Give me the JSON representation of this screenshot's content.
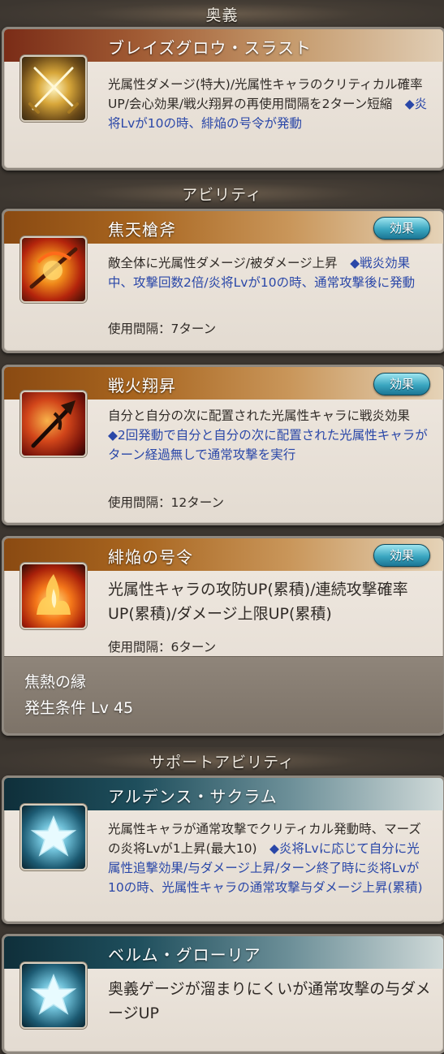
{
  "sections": {
    "ougi": "奥義",
    "abilities": "アビリティ",
    "support": "サポートアビリティ"
  },
  "ougi_card": {
    "name": "ブレイズグロウ・スラスト",
    "desc_plain": "光属性ダメージ(特大)/光属性キャラのクリティカル確率UP/会心効果/戦火翔昇の再使用間隔を2ターン短縮　",
    "desc_blue": "◆炎将Lvが10の時、緋焔の号令が発動",
    "icon": "crossed-swords-icon"
  },
  "abilities": [
    {
      "name": "焦天槍斧",
      "effect_label": "効果",
      "desc_plain": "敵全体に光属性ダメージ/被ダメージ上昇　",
      "desc_blue": "◆戦炎効果中、攻撃回数2倍/炎将Lvが10の時、通常攻撃後に発動",
      "interval": "使用間隔：7ターン",
      "icon": "fire-spear-icon"
    },
    {
      "name": "戦火翔昇",
      "effect_label": "効果",
      "desc_plain": "自分と自分の次に配置された光属性キャラに戦炎効果　",
      "desc_blue": "◆2回発動で自分と自分の次に配置された光属性キャラがターン経過無しで通常攻撃を実行",
      "interval": "使用間隔：12ターン",
      "icon": "halberd-icon"
    },
    {
      "name": "緋焔の号令",
      "effect_label": "効果",
      "desc_plain": "光属性キャラの攻防UP(累積)/連続攻撃確率UP(累積)/ダメージ上限UP(累積)",
      "interval": "使用間隔：6ターン",
      "condition_name": "焦熱の縁",
      "condition_level": "発生条件 Lv 45",
      "icon": "flame-burst-icon"
    }
  ],
  "support_abilities": [
    {
      "name": "アルデンス・サクラム",
      "desc_plain": "光属性キャラが通常攻撃でクリティカル発動時、マーズの炎将Lvが1上昇(最大10)　",
      "desc_blue": "◆炎将Lvに応じて自分に光属性追撃効果/与ダメージ上昇/ターン終了時に炎将Lvが10の時、光属性キャラの通常攻撃与ダメージ上昇(累積)",
      "icon": "star-icon"
    },
    {
      "name": "ベルム・グローリア",
      "desc_plain": "奥義ゲージが溜まりにくいが通常攻撃の与ダメージUP",
      "icon": "star-icon"
    }
  ]
}
